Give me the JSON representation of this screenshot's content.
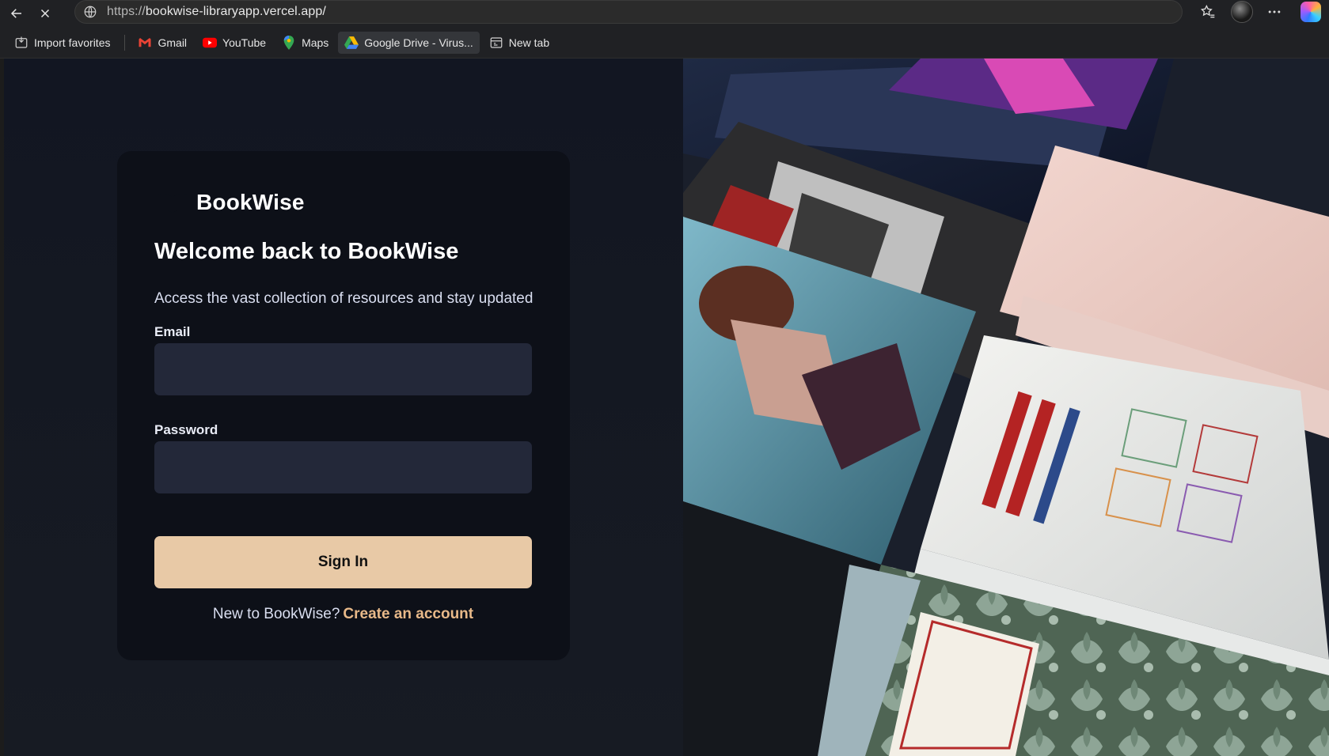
{
  "browser": {
    "url_scheme": "https://",
    "url_host": "bookwise-libraryapp.vercel.app/",
    "bookmarks": [
      {
        "label": "Import favorites",
        "icon": "import-icon"
      },
      {
        "label": "Gmail",
        "icon": "gmail-icon"
      },
      {
        "label": "YouTube",
        "icon": "youtube-icon"
      },
      {
        "label": "Maps",
        "icon": "maps-icon"
      },
      {
        "label": "Google Drive - Virus...",
        "icon": "google-drive-icon"
      },
      {
        "label": "New tab",
        "icon": "new-tab-icon"
      }
    ]
  },
  "login": {
    "brand": "BookWise",
    "title": "Welcome back to BookWise",
    "subtitle": "Access the vast collection of resources and stay updated",
    "email_label": "Email",
    "email_value": "",
    "password_label": "Password",
    "password_value": "",
    "signin_label": "Sign In",
    "footer_text": "New to BookWise?",
    "footer_link": "Create an account"
  },
  "colors": {
    "accent": "#e8c9a6",
    "link": "#e8b989",
    "input_bg": "#232839",
    "card_bg": "#0d1018"
  }
}
